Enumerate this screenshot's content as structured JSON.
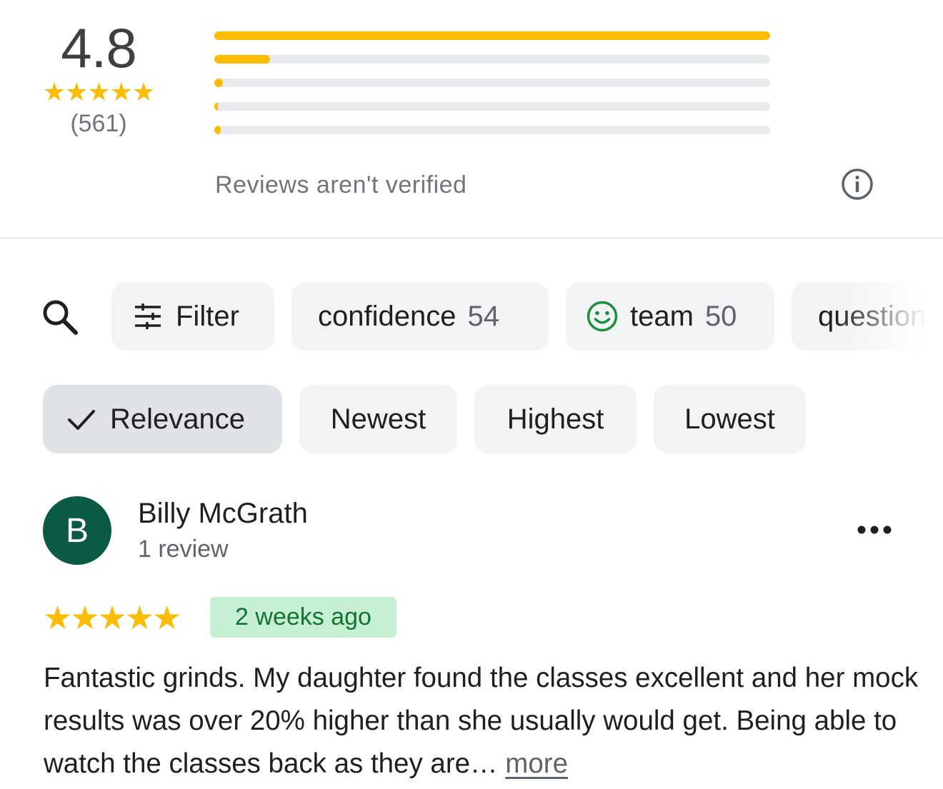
{
  "summary": {
    "average": "4.8",
    "stars": "★★★★★",
    "count": "(561)",
    "bars": [
      {
        "stars": 5,
        "fraction": 1.0
      },
      {
        "stars": 4,
        "fraction": 0.1
      },
      {
        "stars": 3,
        "fraction": 0.015
      },
      {
        "stars": 2,
        "fraction": 0.004
      },
      {
        "stars": 1,
        "fraction": 0.012
      }
    ],
    "disclaimer": "Reviews aren't verified",
    "info_icon": "info-icon"
  },
  "chips": {
    "search_icon": "search-icon",
    "filter_label": "Filter",
    "topics": [
      {
        "label": "confidence",
        "count": "54"
      },
      {
        "label": "team",
        "count": "50",
        "icon": "smiley-icon"
      },
      {
        "label": "question",
        "count": ""
      }
    ]
  },
  "sort": {
    "selected": "Relevance",
    "options": [
      "Relevance",
      "Newest",
      "Highest",
      "Lowest"
    ]
  },
  "review": {
    "avatar_letter": "B",
    "avatar_color": "#0b5a45",
    "author": "Billy McGrath",
    "author_sub": "1 review",
    "rating": 5,
    "stars": "★★★★★",
    "time_badge": "2 weeks ago",
    "text": "Fantastic grinds. My daughter found the classes excellent and her mock results was over 20% higher than she usually would get. Being able to watch the classes back as they are…",
    "more_label": "more"
  },
  "colors": {
    "star": "#fbbc04",
    "bar_track": "#e8eaed",
    "chip_bg": "#f1f3f4",
    "chip_selected_bg": "#dfe3e6",
    "badge_bg": "#c6efd3",
    "badge_text": "#137333",
    "smiley": "#1e8e3e"
  }
}
